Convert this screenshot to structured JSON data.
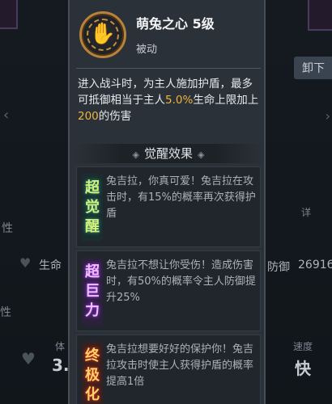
{
  "background": {
    "unload_button": "卸下",
    "attr_label": "性",
    "attr_label2": "性",
    "life_label": "生命",
    "defense_label": "防御",
    "defense_value": "26916",
    "body_label": "体",
    "body_value": "3.",
    "speed_label": "速度",
    "speed_value": "快",
    "detail_label": "详"
  },
  "skill": {
    "name": "萌兔之心 5级",
    "type": "被动",
    "desc_part1": "进入战斗时，为主人施加护盾，最多可抵御相当于主人",
    "desc_pct": "5.0%",
    "desc_part2": "生命上限加上",
    "desc_num": "200",
    "desc_part3": "的伤害"
  },
  "awaken": {
    "title": "觉醒效果",
    "cards": [
      {
        "badge": [
          "超",
          "觉",
          "醒"
        ],
        "text": "兔吉拉，你真可爱！兔吉拉在攻击时，有15%的概率再次获得护盾"
      },
      {
        "badge": [
          "超",
          "巨",
          "力"
        ],
        "text": "兔吉拉不想让你受伤！造成伤害时，有50%的概率令主人防御提升25%"
      },
      {
        "badge": [
          "终",
          "极",
          "化"
        ],
        "text": "兔吉拉想要好好的保护你！兔吉拉攻击时使主人获得护盾的概率提高1倍"
      }
    ]
  },
  "colors": {
    "highlight": "#f0b43c",
    "icon_ring": "#b8823a"
  },
  "icons": {
    "skill": "paw-icon"
  }
}
